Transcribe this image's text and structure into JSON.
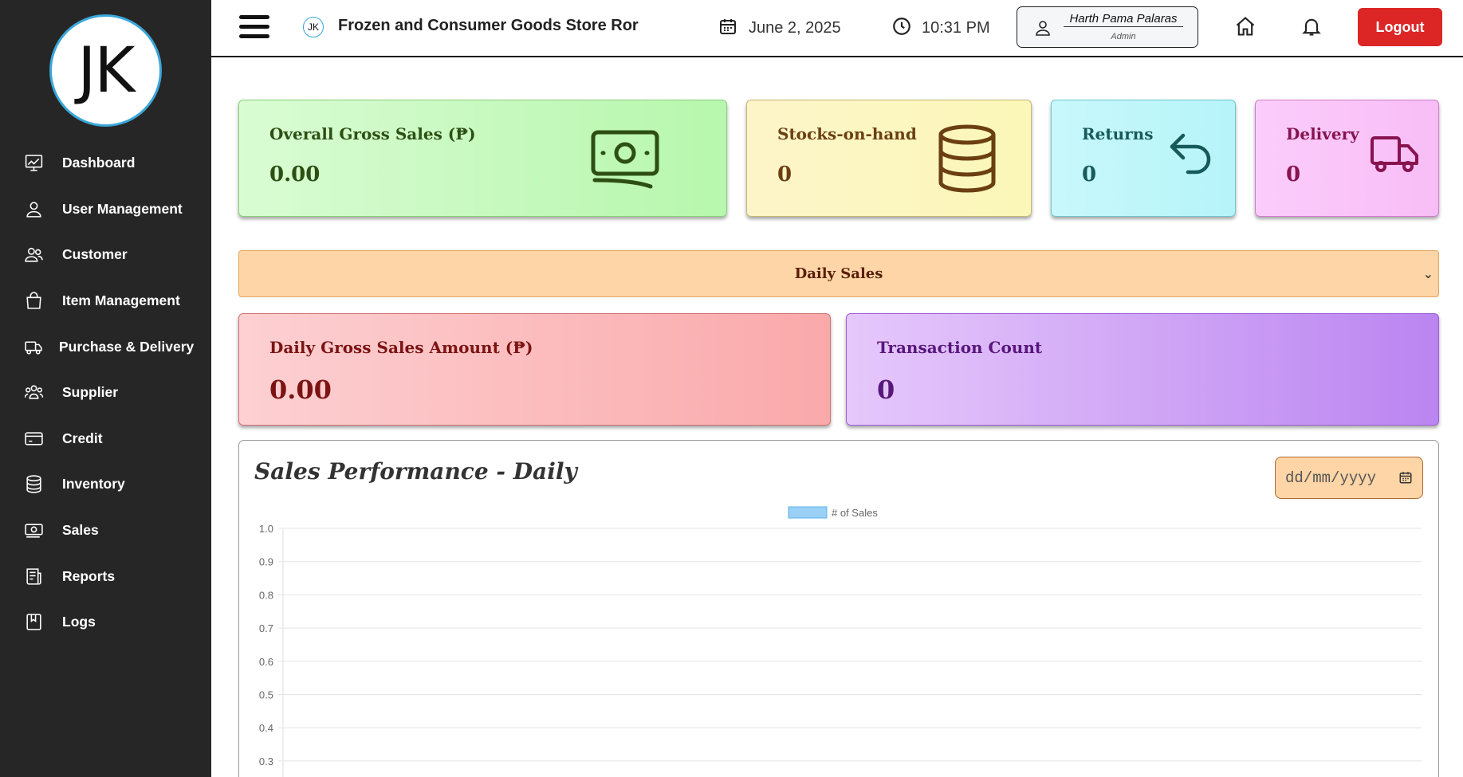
{
  "app": {
    "logo_text": "JK",
    "store_name": "Frozen and Consumer Goods Store Ror",
    "date": "June 2, 2025",
    "time": "10:31 PM",
    "user_name": "Harth Pama Palaras",
    "user_role": "Admin",
    "logout_label": "Logout"
  },
  "sidebar": {
    "items": [
      {
        "label": "Dashboard",
        "icon": "chart-line-icon"
      },
      {
        "label": "User Management",
        "icon": "user-icon"
      },
      {
        "label": "Customer",
        "icon": "users-icon"
      },
      {
        "label": "Item Management",
        "icon": "shopping-bag-icon"
      },
      {
        "label": "Purchase & Delivery",
        "icon": "truck-icon"
      },
      {
        "label": "Supplier",
        "icon": "group-icon"
      },
      {
        "label": "Credit",
        "icon": "credit-card-icon"
      },
      {
        "label": "Inventory",
        "icon": "database-icon"
      },
      {
        "label": "Sales",
        "icon": "cash-icon"
      },
      {
        "label": "Reports",
        "icon": "newspaper-icon"
      },
      {
        "label": "Logs",
        "icon": "book-icon"
      }
    ]
  },
  "cards": {
    "gross": {
      "title": "Overall Gross Sales (₱)",
      "value": "0.00",
      "icon": "cash-icon"
    },
    "stock": {
      "title": "Stocks-on-hand",
      "value": "0",
      "icon": "database-icon"
    },
    "returns": {
      "title": "Returns",
      "value": "0",
      "icon": "return-arrow-icon"
    },
    "delivery": {
      "title": "Delivery",
      "value": "0",
      "icon": "truck-icon"
    }
  },
  "period_select": {
    "selected": "Daily Sales"
  },
  "daily": {
    "gross_title": "Daily Gross Sales Amount (₱)",
    "gross_value": "0.00",
    "tx_title": "Transaction Count",
    "tx_value": "0"
  },
  "chart_panel": {
    "title": "Sales Performance - Daily",
    "date_placeholder": "dd/mm/yyyy"
  },
  "colors": {
    "sidebar_bg": "#262626",
    "logout": "#dc2626",
    "bar_fill": "#9ad0f5"
  },
  "chart_data": {
    "type": "bar",
    "categories": [],
    "series": [
      {
        "name": "# of Sales",
        "values": []
      }
    ],
    "title": "",
    "xlabel": "",
    "ylabel": "",
    "ylim": [
      0,
      1
    ],
    "yticks": [
      "1.0",
      "0.9",
      "0.8",
      "0.7",
      "0.6",
      "0.5",
      "0.4",
      "0.3"
    ],
    "grid": true,
    "legend": "top-center"
  }
}
